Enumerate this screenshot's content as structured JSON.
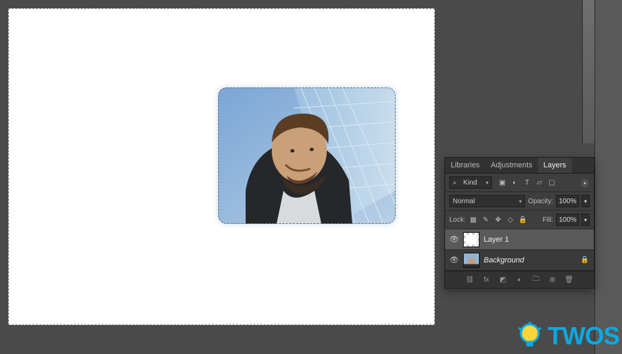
{
  "panel": {
    "tabs": {
      "libraries": "Libraries",
      "adjustments": "Adjustments",
      "layers": "Layers"
    },
    "filter": {
      "kind": "Kind"
    },
    "blend": {
      "mode": "Normal",
      "opacity_label": "Opacity:",
      "opacity_value": "100%"
    },
    "lock": {
      "label": "Lock:",
      "fill_label": "Fill:",
      "fill_value": "100%"
    }
  },
  "layers": [
    {
      "name": "Layer 1",
      "selected": true,
      "italic": false,
      "locked": false
    },
    {
      "name": "Background",
      "selected": false,
      "italic": true,
      "locked": true
    }
  ],
  "icons": {
    "search": "⌕",
    "chevron": "▾",
    "image": "▣",
    "circle_half": "◐",
    "type": "T",
    "shape": "▱",
    "artboard": "▢",
    "eye": "👁",
    "lock_small": "🔒",
    "lock_locked": "🔒",
    "pixel": "▦",
    "brush": "✎",
    "move": "✥",
    "hollow": "◇",
    "link": "⛓",
    "fx": "fx",
    "mask": "◩",
    "adjust": "◐",
    "folder": "🗀",
    "new": "⊞",
    "trash": "🗑"
  },
  "watermark": "TWOS"
}
